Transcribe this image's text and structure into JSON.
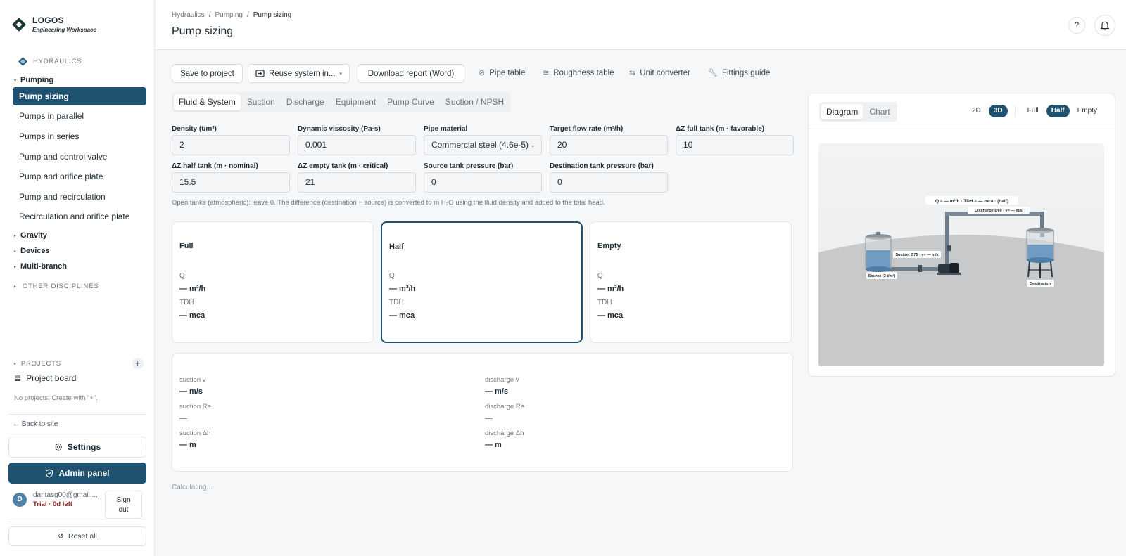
{
  "brand": {
    "title": "LOGOS",
    "subtitle": "Engineering Workspace"
  },
  "sidebar": {
    "section": "HYDRAULICS",
    "groups": {
      "pumping": "Pumping",
      "gravity": "Gravity",
      "devices": "Devices",
      "multibranch": "Multi-branch"
    },
    "items": [
      "Pump sizing",
      "Pumps in parallel",
      "Pumps in series",
      "Pump and control valve",
      "Pump and orifice plate",
      "Pump and recirculation",
      "Recirculation and orifice plate"
    ],
    "other": "OTHER DISCIPLINES",
    "projects_header": "PROJECTS",
    "project_board": "Project board",
    "no_projects": "No projects. Create with \"+\".",
    "back": "← Back to site",
    "settings": "Settings",
    "admin": "Admin panel",
    "user": {
      "initial": "D",
      "email": "dantasg00@gmail....",
      "trial": "Trial · 0d left"
    },
    "signout_1": "Sign",
    "signout_2": "out",
    "reset": "Reset all"
  },
  "header": {
    "breadcrumb": [
      "Hydraulics",
      "/",
      "Pumping",
      "/",
      "Pump sizing"
    ],
    "title": "Pump sizing",
    "help": "?"
  },
  "toolbar": {
    "save": "Save to project",
    "reuse": "Reuse system in...",
    "download": "Download report (Word)",
    "pipe_table": "Pipe table",
    "roughness": "Roughness table",
    "unit_conv": "Unit converter",
    "fittings": "Fittings guide"
  },
  "tabs": [
    "Fluid & System",
    "Suction",
    "Discharge",
    "Equipment",
    "Pump Curve",
    "Suction / NPSH"
  ],
  "form": {
    "density": {
      "label": "Density (t/m³)",
      "value": "2"
    },
    "viscosity": {
      "label": "Dynamic viscosity (Pa·s)",
      "value": "0.001"
    },
    "pipe_material": {
      "label": "Pipe material",
      "value": "Commercial steel (4.6e-5)"
    },
    "flow": {
      "label": "Target flow rate (m³/h)",
      "value": "20"
    },
    "dz_full": {
      "label": "ΔZ full tank (m · favorable)",
      "value": "10"
    },
    "dz_half": {
      "label": "ΔZ half tank (m · nominal)",
      "value": "15.5"
    },
    "dz_empty": {
      "label": "ΔZ empty tank (m · critical)",
      "value": "21"
    },
    "src_p": {
      "label": "Source tank pressure (bar)",
      "value": "0"
    },
    "dst_p": {
      "label": "Destination tank pressure (bar)",
      "value": "0"
    },
    "note": "Open tanks (atmospheric): leave 0. The difference (destination − source) is converted to m H₂O using the fluid density and added to the total head."
  },
  "cards": [
    {
      "title": "Full",
      "q_label": "Q",
      "q_value": "— m³/h",
      "tdh_label": "TDH",
      "tdh_value": "— mca"
    },
    {
      "title": "Half",
      "q_label": "Q",
      "q_value": "— m³/h",
      "tdh_label": "TDH",
      "tdh_value": "— mca"
    },
    {
      "title": "Empty",
      "q_label": "Q",
      "q_value": "— m³/h",
      "tdh_label": "TDH",
      "tdh_value": "— mca"
    }
  ],
  "velocities": {
    "suction_v": {
      "label": "suction v",
      "value": "— m/s"
    },
    "discharge_v": {
      "label": "discharge v",
      "value": "— m/s"
    },
    "suction_re": {
      "label": "suction Re",
      "value": "—"
    },
    "discharge_re": {
      "label": "discharge Re",
      "value": "—"
    },
    "suction_dh": {
      "label": "suction Δh",
      "value": "— m"
    },
    "discharge_dh": {
      "label": "discharge Δh",
      "value": "— m"
    }
  },
  "status": "Calculating...",
  "diagram": {
    "views": [
      "Diagram",
      "Chart"
    ],
    "dims": [
      "2D",
      "3D"
    ],
    "levels": [
      "Full",
      "Half",
      "Empty"
    ],
    "label_main": "Q = — m³/h · TDH = — mca · (half)",
    "label_discharge": "Discharge Ø60 · v= — m/s",
    "label_suction": "Suction Ø75 · v= — m/s",
    "label_source": "Source (2 t/m³)",
    "label_dest": "Destination"
  },
  "colors": {
    "accent": "#1f5270",
    "trial": "#8a2020"
  }
}
